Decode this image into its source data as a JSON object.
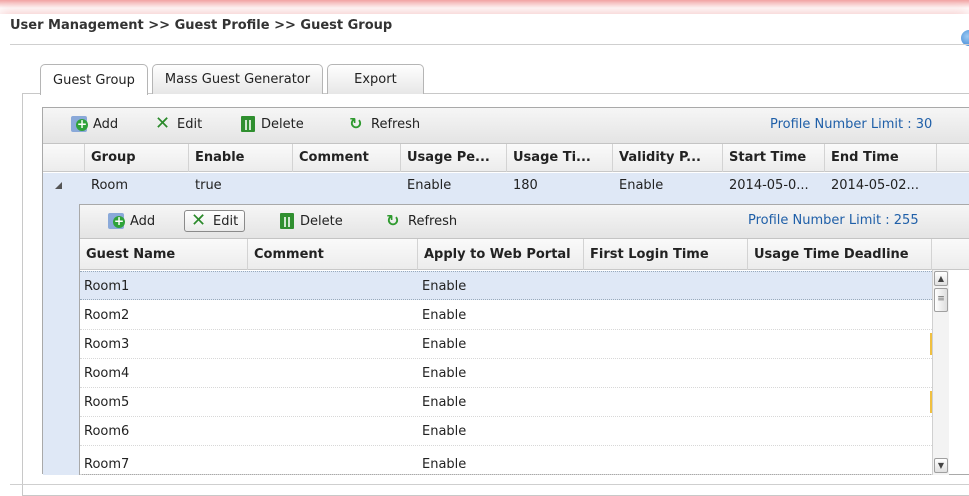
{
  "breadcrumb": "User Management >> Guest Profile >> Guest Group",
  "tabs": [
    {
      "label": "Guest Group",
      "active": true
    },
    {
      "label": "Mass Guest Generator",
      "active": false
    },
    {
      "label": "Export",
      "active": false
    }
  ],
  "toolbar": {
    "add": "Add",
    "edit": "Edit",
    "delete": "Delete",
    "refresh": "Refresh",
    "limit": "Profile Number Limit : 30"
  },
  "group_table": {
    "columns": [
      "Group",
      "Enable",
      "Comment",
      "Usage Pe...",
      "Usage Ti...",
      "Validity P...",
      "Start Time",
      "End Time"
    ],
    "row": {
      "group": "Room",
      "enable": "true",
      "comment": "",
      "usage_period": "Enable",
      "usage_time": "180",
      "validity_period": "Enable",
      "start_time": "2014-05-0...",
      "end_time": "2014-05-02..."
    }
  },
  "sub_toolbar": {
    "add": "Add",
    "edit": "Edit",
    "delete": "Delete",
    "refresh": "Refresh",
    "limit": "Profile Number Limit : 255"
  },
  "guest_table": {
    "columns": [
      "Guest Name",
      "Comment",
      "Apply to Web Portal",
      "First Login Time",
      "Usage Time Deadline"
    ],
    "rows": [
      {
        "name": "Room1",
        "comment": "",
        "portal": "Enable",
        "first_login": "",
        "deadline": ""
      },
      {
        "name": "Room2",
        "comment": "",
        "portal": "Enable",
        "first_login": "",
        "deadline": ""
      },
      {
        "name": "Room3",
        "comment": "",
        "portal": "Enable",
        "first_login": "",
        "deadline": ""
      },
      {
        "name": "Room4",
        "comment": "",
        "portal": "Enable",
        "first_login": "",
        "deadline": ""
      },
      {
        "name": "Room5",
        "comment": "",
        "portal": "Enable",
        "first_login": "",
        "deadline": ""
      },
      {
        "name": "Room6",
        "comment": "",
        "portal": "Enable",
        "first_login": "",
        "deadline": ""
      },
      {
        "name": "Room7",
        "comment": "",
        "portal": "Enable",
        "first_login": "",
        "deadline": ""
      }
    ]
  },
  "colors": {
    "accent_text": "#1f5fa8",
    "selected_row": "#dfe8f6",
    "icon_green": "#2f9a2f"
  }
}
